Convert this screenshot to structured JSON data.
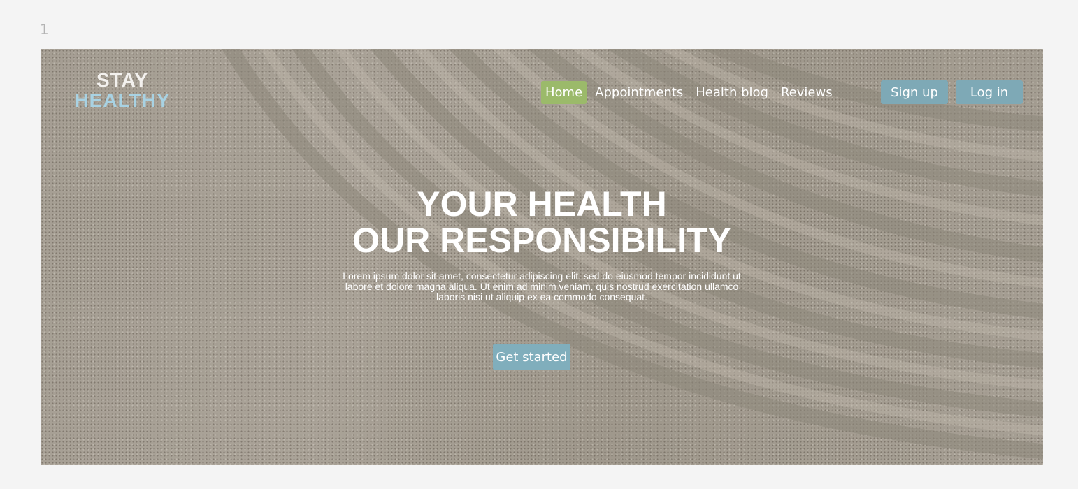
{
  "frame_label": "1",
  "logo": {
    "line1": "STAY",
    "line2": "HEALTHY"
  },
  "nav": {
    "items": [
      "Home",
      "Appointments",
      "Health blog",
      "Reviews"
    ],
    "active": "Home"
  },
  "auth": {
    "signup_label": "Sign up",
    "login_label": "Log in"
  },
  "hero": {
    "headline_line1": "YOUR HEALTH",
    "headline_line2": "OUR RESPONSIBILITY",
    "body": "Lorem ipsum dolor sit amet, consectetur adipiscing elit, sed do eiusmod tempor incididunt ut labore et dolore magna aliqua. Ut enim ad minim veniam, quis nostrud exercitation ullamco laboris nisi ut aliquip ex ea commodo consequat.",
    "cta_label": "Get started"
  },
  "colors": {
    "page_background": "#f4f4f4",
    "nav_active": "#9bba6a",
    "button": "#7ea9b6",
    "logo_accent": "#a8d2e3"
  }
}
